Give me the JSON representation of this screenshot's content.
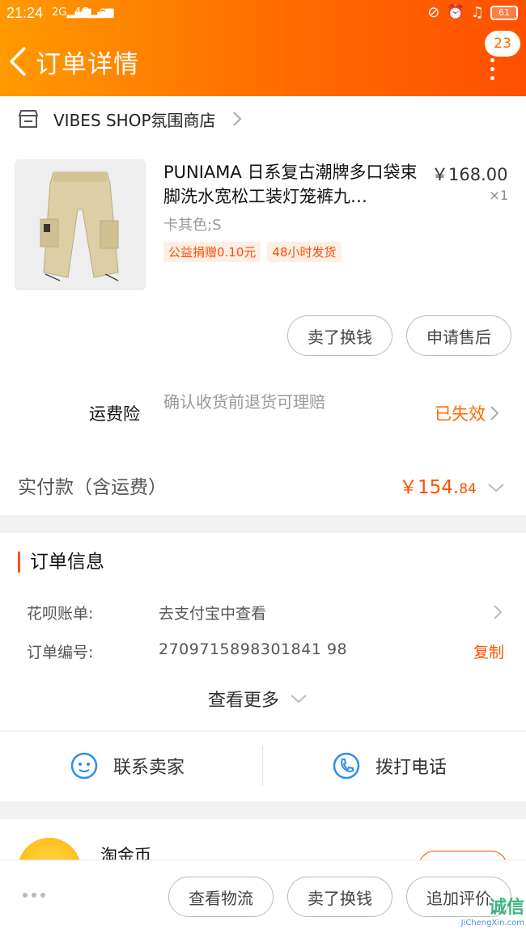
{
  "status_bar": {
    "time": "21:24",
    "network1": "2G",
    "network2": "4G",
    "battery": "61"
  },
  "header": {
    "title": "订单详情",
    "badge_count": "23"
  },
  "shop": {
    "name": "VIBES SHOP氛围商店"
  },
  "item": {
    "name": "PUNIAMA 日系复古潮牌多口袋束脚洗水宽松工装灯笼裤九…",
    "price": "￥168.00",
    "qty": "×1",
    "sku": "卡其色;S",
    "tags": [
      "公益捐赠0.10元",
      "48小时发货"
    ],
    "actions": [
      "卖了换钱",
      "申请售后"
    ]
  },
  "insurance": {
    "label": "运费险",
    "desc": "确认收货前退货可理赔",
    "status": "已失效"
  },
  "payment": {
    "label": "实付款（含运费）",
    "value_main": "￥154.",
    "value_cents": "84"
  },
  "order_info": {
    "title": "订单信息",
    "rows": [
      {
        "label": "花呗账单:",
        "value": "去支付宝中查看"
      },
      {
        "label": "订单编号:",
        "value": "2709715898301841 98"
      }
    ],
    "copy_label": "复制",
    "see_more": "查看更多"
  },
  "contact": {
    "seller": "联系卖家",
    "phone": "拨打电话"
  },
  "coins": {
    "label": "淘金币"
  },
  "bottom_bar": {
    "buttons": [
      "查看物流",
      "卖了换钱",
      "追加评价"
    ]
  },
  "watermark": {
    "text": "诚信",
    "sub": "JiChengXin.com"
  },
  "colors": {
    "accent": "#ff5000",
    "header_start": "#ff9a00",
    "header_end": "#ff5000"
  }
}
